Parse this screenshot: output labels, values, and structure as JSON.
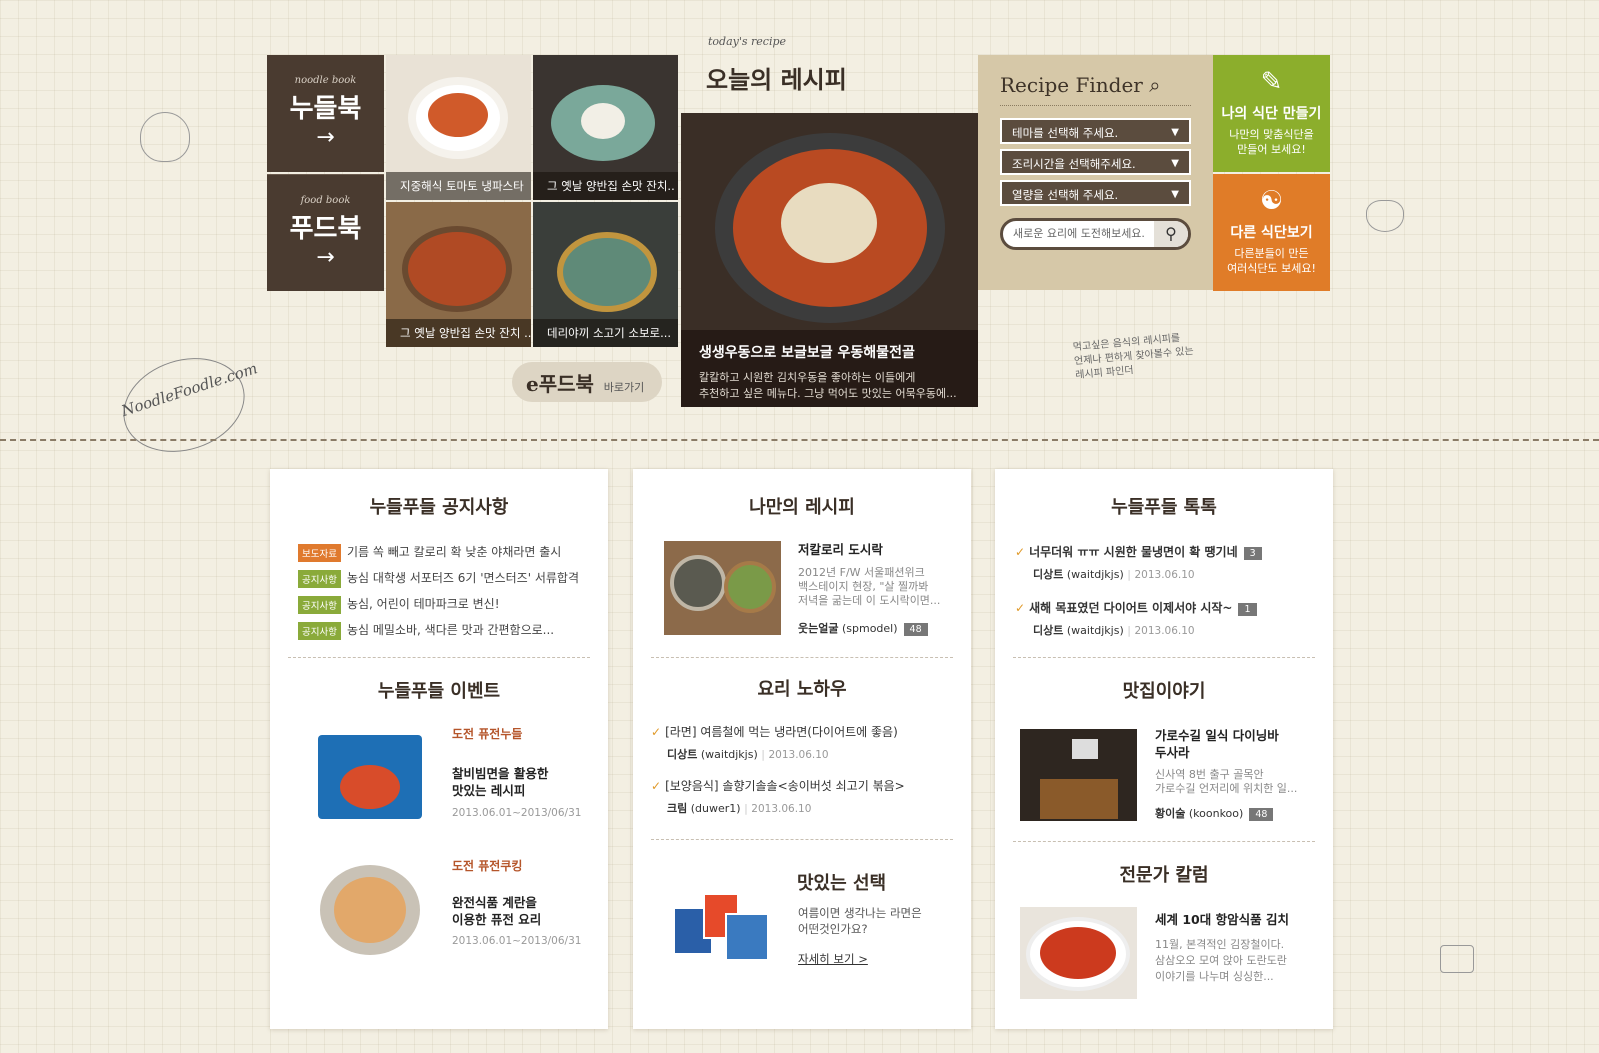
{
  "books": [
    {
      "sub": "noodle book",
      "main": "누들북",
      "arrow": "→"
    },
    {
      "sub": "food book",
      "main": "푸드북",
      "arrow": "→"
    }
  ],
  "photos": [
    {
      "caption": "지중해식 토마토 냉파스타"
    },
    {
      "caption": "그 옛날 양반집 손맛 잔치.."
    },
    {
      "caption": "그 옛날 양반집 손맛 잔치 ..."
    },
    {
      "caption": "데리야끼 소고기 소보로..."
    }
  ],
  "efoodbook": {
    "label": "e푸드북",
    "link": "바로가기"
  },
  "today": {
    "eng": "today's recipe",
    "kor": "오늘의 레시피",
    "title": "생생우동으로 보글보글 우동해물전골",
    "desc1": "칼칼하고 시원한 김치우동을 좋아하는 이들에게",
    "desc2": "추천하고 싶은 메뉴다. 그냥 먹어도 맛있는 어묵우동에..."
  },
  "finder": {
    "title": "Recipe Finder",
    "selects": [
      "테마를 선택해 주세요.",
      "조리시간을 선택해주세요.",
      "열량을 선택해 주세요."
    ],
    "placeholder": "새로운 요리에 도전해보세요.",
    "note1": "먹고싶은 음식의 레시피를",
    "note2": "언제나 편하게 찾아볼수 있는",
    "note3": "레시피 파인더"
  },
  "tiles": [
    {
      "title": "나의 식단 만들기",
      "desc1": "나만의 맞춤식단을",
      "desc2": "만들어 보세요!",
      "color": "#8cae2c"
    },
    {
      "title": "다른 식단보기",
      "desc1": "다른분들이 만든",
      "desc2": "여러식단도 보세요!",
      "color": "#e07c28"
    }
  ],
  "logo": "NoodleFoodle.com",
  "left": {
    "notice_title": "누들푸들 공지사항",
    "notices": [
      {
        "tag": "보도자료",
        "text": "기름 쏙 빼고 칼로리 확 낮춘 야채라면 출시"
      },
      {
        "tag": "공지사항",
        "text": "농심 대학생 서포터즈 6기 '면스터즈' 서류합격"
      },
      {
        "tag": "공지사항",
        "text": "농심, 어린이 테마파크로 변신!"
      },
      {
        "tag": "공지사항",
        "text": "농심 메밀소바, 색다른 맛과 간편함으로..."
      }
    ],
    "event_title": "누들푸들 이벤트",
    "events": [
      {
        "label": "도전 퓨전누들",
        "title1": "찰비빔면을 활용한",
        "title2": "맛있는 레시피",
        "date": "2013.06.01~2013/06/31"
      },
      {
        "label": "도전 퓨전쿠킹",
        "title1": "완전식품 계란을",
        "title2": "이용한 퓨전 요리",
        "date": "2013.06.01~2013/06/31"
      }
    ]
  },
  "mid": {
    "myrecipe_title": "나만의 레시피",
    "myrecipe": {
      "title": "저칼로리 도시락",
      "desc1": "2012년 F/W 서울패션위크",
      "desc2": "백스테이지 현장, \"살 찔까봐",
      "desc3": "저녁을 굶는데 이 도시락이면...",
      "user": "웃는얼굴",
      "id": "(spmodel)",
      "count": "48"
    },
    "knowhow_title": "요리 노하우",
    "knowhow": [
      {
        "text": "[라면] 여름철에 먹는 냉라면(다이어트에 좋음)",
        "user": "디상트",
        "id": "(waitdjkjs)",
        "date": "2013.06.10"
      },
      {
        "text": "[보양음식] 솔향기솔솔<송이버섯 쇠고기 볶음>",
        "user": "크림",
        "id": "(duwer1)",
        "date": "2013.06.10"
      }
    ],
    "choice_title": "맛있는 선택",
    "choice": {
      "desc1": "여름이면 생각나는 라면은",
      "desc2": "어떤것인가요?",
      "link": "자세히 보기 >"
    }
  },
  "right": {
    "talk_title": "누들푸들 톡톡",
    "talks": [
      {
        "text": "너무더워 ㅠㅠ 시원한 물냉면이 확 땡기네",
        "count": "3",
        "user": "디상트",
        "id": "(waitdjkjs)",
        "date": "2013.06.10"
      },
      {
        "text": "새해 목표였던 다이어트 이제서야 시작~",
        "count": "1",
        "user": "디상트",
        "id": "(waitdjkjs)",
        "date": "2013.06.10"
      }
    ],
    "story_title": "맛집이야기",
    "story": {
      "title1": "가로수길 일식 다이닝바",
      "title2": "두사라",
      "desc1": "신사역 8번 출구 골목안",
      "desc2": "가로수길 언저리에 위치한 일...",
      "user": "황이술",
      "id": "(koonkoo)",
      "count": "48"
    },
    "column_title": "전문가 칼럼",
    "column": {
      "title": "세계 10대 항암식품 김치",
      "desc1": "11월, 본격적인 김장철이다.",
      "desc2": "삼삼오오 모여 앉아 도란도란",
      "desc3": "이야기를 나누며 싱싱한..."
    }
  }
}
